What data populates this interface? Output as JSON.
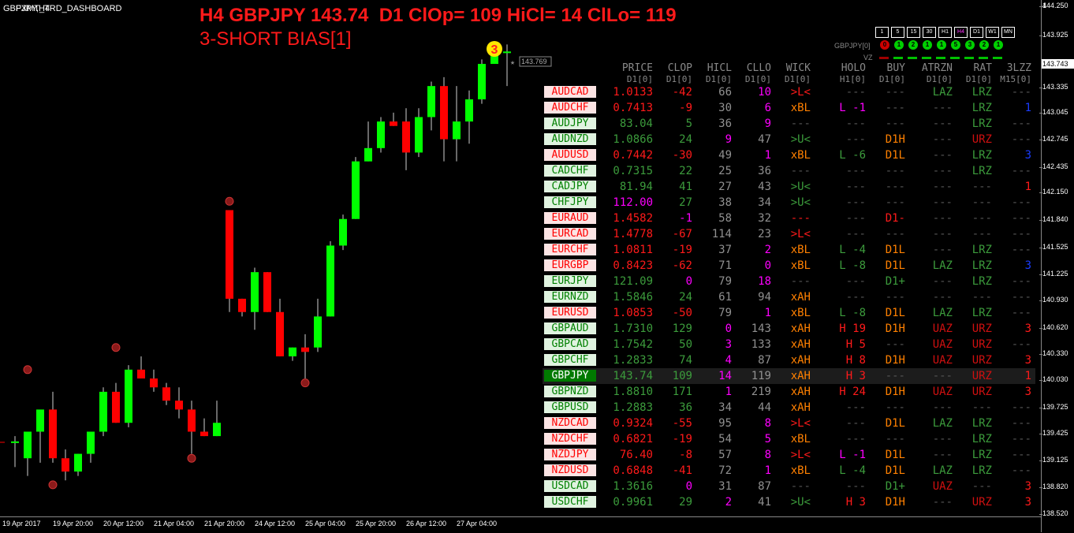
{
  "window": {
    "symbol_label": "GBPJPY,H4",
    "indicator_label": "FXMT_TRD_DASHBOARD"
  },
  "header": {
    "line1": "H4 GBPJPY 143.74  D1 ClOp= 109 HiCl= 14 ClLo= 119",
    "line2": "3-SHORT BIAS[1]",
    "color": "#ff1a1a"
  },
  "badge": {
    "text": "3",
    "color": "#ffe600"
  },
  "price_label": "143.769",
  "current_price": "143.743",
  "price_axis": [
    "144.250",
    "143.925",
    "143.743",
    "143.335",
    "143.045",
    "142.745",
    "142.435",
    "142.150",
    "141.840",
    "141.525",
    "141.225",
    "140.930",
    "140.620",
    "140.330",
    "140.030",
    "139.725",
    "139.425",
    "139.125",
    "138.820",
    "138.520"
  ],
  "time_axis": [
    "19 Apr 2017",
    "19 Apr 20:00",
    "20 Apr 12:00",
    "21 Apr 04:00",
    "21 Apr 20:00",
    "24 Apr 12:00",
    "25 Apr 04:00",
    "25 Apr 20:00",
    "26 Apr 12:00",
    "27 Apr 04:00"
  ],
  "timeframes": [
    "1",
    "5",
    "15",
    "30",
    "H1",
    "H4",
    "D1",
    "W1",
    "MN"
  ],
  "active_timeframe": "H4",
  "pair_label": "GBPJPY[0]",
  "signals": [
    {
      "text": "0",
      "color": "red"
    },
    {
      "text": "1",
      "color": "green"
    },
    {
      "text": "2",
      "color": "green"
    },
    {
      "text": "1",
      "color": "green"
    },
    {
      "text": "1",
      "color": "green"
    },
    {
      "text": "5",
      "color": "green"
    },
    {
      "text": "3",
      "color": "green"
    },
    {
      "text": "2",
      "color": "green"
    },
    {
      "text": "1",
      "color": "green"
    }
  ],
  "vz_label": "VZ",
  "vz_bars": [
    "red",
    "green",
    "green",
    "green",
    "green",
    "green",
    "green",
    "green",
    "green"
  ],
  "columns": [
    {
      "name": "PRICE",
      "sub": "D1[0]"
    },
    {
      "name": "CLOP",
      "sub": "D1[0]"
    },
    {
      "name": "HICL",
      "sub": "D1[0]"
    },
    {
      "name": "CLLO",
      "sub": "D1[0]"
    },
    {
      "name": "WICK",
      "sub": "D1[0]"
    },
    {
      "name": "HOLO",
      "sub": "H1[0]"
    },
    {
      "name": "BUY",
      "sub": "D1[0]"
    },
    {
      "name": "ATRZN",
      "sub": "D1[0]"
    },
    {
      "name": "RAT",
      "sub": "D1[0]"
    },
    {
      "name": "3LZZ",
      "sub": "M15[0]"
    }
  ],
  "rows": [
    {
      "pair": "AUDCAD",
      "style": "red",
      "price": "1.0133",
      "price_c": "cR",
      "clop": "-42",
      "clop_c": "cR",
      "hicl": "66",
      "hicl_c": "cGr",
      "cllo": "10",
      "cllo_c": "cM",
      "wick": ">L<",
      "wick_c": "cR",
      "holo": "---",
      "holo_c": "cDk",
      "buy": "---",
      "buy_c": "cDk",
      "atr": "LAZ",
      "atr_c": "cDG",
      "rat": "LRZ",
      "rat_c": "cDG",
      "lzz": "---",
      "lzz_c": "cDk"
    },
    {
      "pair": "AUDCHF",
      "style": "red",
      "price": "0.7413",
      "price_c": "cR",
      "clop": "-9",
      "clop_c": "cR",
      "hicl": "30",
      "hicl_c": "cGr",
      "cllo": "6",
      "cllo_c": "cM",
      "wick": "xBL",
      "wick_c": "cO",
      "holo": "L -1",
      "holo_c": "cM",
      "buy": "---",
      "buy_c": "cDk",
      "atr": "---",
      "atr_c": "cDk",
      "rat": "LRZ",
      "rat_c": "cDG",
      "lzz": "1",
      "lzz_c": "cB"
    },
    {
      "pair": "AUDJPY",
      "style": "green",
      "price": "83.04",
      "price_c": "cDG",
      "clop": "5",
      "clop_c": "cDG",
      "hicl": "36",
      "hicl_c": "cGr",
      "cllo": "9",
      "cllo_c": "cM",
      "wick": "---",
      "wick_c": "cDk",
      "holo": "---",
      "holo_c": "cDk",
      "buy": "---",
      "buy_c": "cDk",
      "atr": "---",
      "atr_c": "cDk",
      "rat": "LRZ",
      "rat_c": "cDG",
      "lzz": "---",
      "lzz_c": "cDk"
    },
    {
      "pair": "AUDNZD",
      "style": "green",
      "price": "1.0866",
      "price_c": "cDG",
      "clop": "24",
      "clop_c": "cDG",
      "hicl": "9",
      "hicl_c": "cM",
      "cllo": "47",
      "cllo_c": "cGr",
      "wick": ">U<",
      "wick_c": "cDG",
      "holo": "---",
      "holo_c": "cDk",
      "buy": "D1H",
      "buy_c": "cO",
      "atr": "---",
      "atr_c": "cDk",
      "rat": "URZ",
      "rat_c": "cDR",
      "lzz": "---",
      "lzz_c": "cDk"
    },
    {
      "pair": "AUDUSD",
      "style": "red",
      "price": "0.7442",
      "price_c": "cR",
      "clop": "-30",
      "clop_c": "cR",
      "hicl": "49",
      "hicl_c": "cGr",
      "cllo": "1",
      "cllo_c": "cM",
      "wick": "xBL",
      "wick_c": "cO",
      "holo": "L -6",
      "holo_c": "cDG",
      "buy": "D1L",
      "buy_c": "cO",
      "atr": "---",
      "atr_c": "cDk",
      "rat": "LRZ",
      "rat_c": "cDG",
      "lzz": "3",
      "lzz_c": "cB"
    },
    {
      "pair": "CADCHF",
      "style": "green",
      "price": "0.7315",
      "price_c": "cDG",
      "clop": "22",
      "clop_c": "cDG",
      "hicl": "25",
      "hicl_c": "cGr",
      "cllo": "36",
      "cllo_c": "cGr",
      "wick": "---",
      "wick_c": "cDk",
      "holo": "---",
      "holo_c": "cDk",
      "buy": "---",
      "buy_c": "cDk",
      "atr": "---",
      "atr_c": "cDk",
      "rat": "LRZ",
      "rat_c": "cDG",
      "lzz": "---",
      "lzz_c": "cDk"
    },
    {
      "pair": "CADJPY",
      "style": "green",
      "price": "81.94",
      "price_c": "cDG",
      "clop": "41",
      "clop_c": "cDG",
      "hicl": "27",
      "hicl_c": "cGr",
      "cllo": "43",
      "cllo_c": "cGr",
      "wick": ">U<",
      "wick_c": "cDG",
      "holo": "---",
      "holo_c": "cDk",
      "buy": "---",
      "buy_c": "cDk",
      "atr": "---",
      "atr_c": "cDk",
      "rat": "---",
      "rat_c": "cDk",
      "lzz": "1",
      "lzz_c": "cR"
    },
    {
      "pair": "CHFJPY",
      "style": "green",
      "price": "112.00",
      "price_c": "cM",
      "clop": "27",
      "clop_c": "cDG",
      "hicl": "38",
      "hicl_c": "cGr",
      "cllo": "34",
      "cllo_c": "cGr",
      "wick": ">U<",
      "wick_c": "cDG",
      "holo": "---",
      "holo_c": "cDk",
      "buy": "---",
      "buy_c": "cDk",
      "atr": "---",
      "atr_c": "cDk",
      "rat": "---",
      "rat_c": "cDk",
      "lzz": "---",
      "lzz_c": "cDk"
    },
    {
      "pair": "EURAUD",
      "style": "red",
      "price": "1.4582",
      "price_c": "cR",
      "clop": "-1",
      "clop_c": "cM",
      "hicl": "58",
      "hicl_c": "cGr",
      "cllo": "32",
      "cllo_c": "cGr",
      "wick": "---",
      "wick_c": "cR",
      "holo": "---",
      "holo_c": "cDk",
      "buy": "D1-",
      "buy_c": "cR",
      "atr": "---",
      "atr_c": "cDk",
      "rat": "---",
      "rat_c": "cDk",
      "lzz": "---",
      "lzz_c": "cDk"
    },
    {
      "pair": "EURCAD",
      "style": "red",
      "price": "1.4778",
      "price_c": "cR",
      "clop": "-67",
      "clop_c": "cR",
      "hicl": "114",
      "hicl_c": "cGr",
      "cllo": "23",
      "cllo_c": "cGr",
      "wick": ">L<",
      "wick_c": "cR",
      "holo": "---",
      "holo_c": "cDk",
      "buy": "---",
      "buy_c": "cDk",
      "atr": "---",
      "atr_c": "cDk",
      "rat": "---",
      "rat_c": "cDk",
      "lzz": "---",
      "lzz_c": "cDk"
    },
    {
      "pair": "EURCHF",
      "style": "red",
      "price": "1.0811",
      "price_c": "cR",
      "clop": "-19",
      "clop_c": "cR",
      "hicl": "37",
      "hicl_c": "cGr",
      "cllo": "2",
      "cllo_c": "cM",
      "wick": "xBL",
      "wick_c": "cO",
      "holo": "L -4",
      "holo_c": "cDG",
      "buy": "D1L",
      "buy_c": "cO",
      "atr": "---",
      "atr_c": "cDk",
      "rat": "LRZ",
      "rat_c": "cDG",
      "lzz": "---",
      "lzz_c": "cDk"
    },
    {
      "pair": "EURGBP",
      "style": "red",
      "price": "0.8423",
      "price_c": "cR",
      "clop": "-62",
      "clop_c": "cR",
      "hicl": "71",
      "hicl_c": "cGr",
      "cllo": "0",
      "cllo_c": "cM",
      "wick": "xBL",
      "wick_c": "cO",
      "holo": "L -8",
      "holo_c": "cDG",
      "buy": "D1L",
      "buy_c": "cO",
      "atr": "LAZ",
      "atr_c": "cDG",
      "rat": "LRZ",
      "rat_c": "cDG",
      "lzz": "3",
      "lzz_c": "cB"
    },
    {
      "pair": "EURJPY",
      "style": "green",
      "price": "121.09",
      "price_c": "cDG",
      "clop": "0",
      "clop_c": "cM",
      "hicl": "79",
      "hicl_c": "cGr",
      "cllo": "18",
      "cllo_c": "cM",
      "wick": "---",
      "wick_c": "cDk",
      "holo": "---",
      "holo_c": "cDk",
      "buy": "D1+",
      "buy_c": "cDG",
      "atr": "---",
      "atr_c": "cDk",
      "rat": "LRZ",
      "rat_c": "cDG",
      "lzz": "---",
      "lzz_c": "cDk"
    },
    {
      "pair": "EURNZD",
      "style": "green",
      "price": "1.5846",
      "price_c": "cDG",
      "clop": "24",
      "clop_c": "cDG",
      "hicl": "61",
      "hicl_c": "cGr",
      "cllo": "94",
      "cllo_c": "cGr",
      "wick": "xAH",
      "wick_c": "cO",
      "holo": "---",
      "holo_c": "cDk",
      "buy": "---",
      "buy_c": "cDk",
      "atr": "---",
      "atr_c": "cDk",
      "rat": "---",
      "rat_c": "cDk",
      "lzz": "---",
      "lzz_c": "cDk"
    },
    {
      "pair": "EURUSD",
      "style": "red",
      "price": "1.0853",
      "price_c": "cR",
      "clop": "-50",
      "clop_c": "cR",
      "hicl": "79",
      "hicl_c": "cGr",
      "cllo": "1",
      "cllo_c": "cM",
      "wick": "xBL",
      "wick_c": "cO",
      "holo": "L -8",
      "holo_c": "cDG",
      "buy": "D1L",
      "buy_c": "cO",
      "atr": "LAZ",
      "atr_c": "cDG",
      "rat": "LRZ",
      "rat_c": "cDG",
      "lzz": "---",
      "lzz_c": "cDk"
    },
    {
      "pair": "GBPAUD",
      "style": "green",
      "price": "1.7310",
      "price_c": "cDG",
      "clop": "129",
      "clop_c": "cDG",
      "hicl": "0",
      "hicl_c": "cM",
      "cllo": "143",
      "cllo_c": "cGr",
      "wick": "xAH",
      "wick_c": "cO",
      "holo": "H 19",
      "holo_c": "cR",
      "buy": "D1H",
      "buy_c": "cO",
      "atr": "UAZ",
      "atr_c": "cDR",
      "rat": "URZ",
      "rat_c": "cDR",
      "lzz": "3",
      "lzz_c": "cR"
    },
    {
      "pair": "GBPCAD",
      "style": "green",
      "price": "1.7542",
      "price_c": "cDG",
      "clop": "50",
      "clop_c": "cDG",
      "hicl": "3",
      "hicl_c": "cM",
      "cllo": "133",
      "cllo_c": "cGr",
      "wick": "xAH",
      "wick_c": "cO",
      "holo": "H 5",
      "holo_c": "cR",
      "buy": "---",
      "buy_c": "cDk",
      "atr": "UAZ",
      "atr_c": "cDR",
      "rat": "URZ",
      "rat_c": "cDR",
      "lzz": "---",
      "lzz_c": "cDk"
    },
    {
      "pair": "GBPCHF",
      "style": "green",
      "price": "1.2833",
      "price_c": "cDG",
      "clop": "74",
      "clop_c": "cDG",
      "hicl": "4",
      "hicl_c": "cM",
      "cllo": "87",
      "cllo_c": "cGr",
      "wick": "xAH",
      "wick_c": "cO",
      "holo": "H 8",
      "holo_c": "cR",
      "buy": "D1H",
      "buy_c": "cO",
      "atr": "UAZ",
      "atr_c": "cDR",
      "rat": "URZ",
      "rat_c": "cDR",
      "lzz": "3",
      "lzz_c": "cR"
    },
    {
      "pair": "GBPJPY",
      "style": "sel",
      "price": "143.74",
      "price_c": "cDG",
      "clop": "109",
      "clop_c": "cDG",
      "hicl": "14",
      "hicl_c": "cM",
      "cllo": "119",
      "cllo_c": "cGr",
      "wick": "xAH",
      "wick_c": "cO",
      "holo": "H 3",
      "holo_c": "cR",
      "buy": "---",
      "buy_c": "cDk",
      "atr": "---",
      "atr_c": "cDk",
      "rat": "URZ",
      "rat_c": "cDR",
      "lzz": "1",
      "lzz_c": "cR"
    },
    {
      "pair": "GBPNZD",
      "style": "green",
      "price": "1.8810",
      "price_c": "cDG",
      "clop": "171",
      "clop_c": "cDG",
      "hicl": "1",
      "hicl_c": "cM",
      "cllo": "219",
      "cllo_c": "cGr",
      "wick": "xAH",
      "wick_c": "cO",
      "holo": "H 24",
      "holo_c": "cR",
      "buy": "D1H",
      "buy_c": "cO",
      "atr": "UAZ",
      "atr_c": "cDR",
      "rat": "URZ",
      "rat_c": "cDR",
      "lzz": "3",
      "lzz_c": "cR"
    },
    {
      "pair": "GBPUSD",
      "style": "green",
      "price": "1.2883",
      "price_c": "cDG",
      "clop": "36",
      "clop_c": "cDG",
      "hicl": "34",
      "hicl_c": "cGr",
      "cllo": "44",
      "cllo_c": "cGr",
      "wick": "xAH",
      "wick_c": "cO",
      "holo": "---",
      "holo_c": "cDk",
      "buy": "---",
      "buy_c": "cDk",
      "atr": "---",
      "atr_c": "cDk",
      "rat": "---",
      "rat_c": "cDk",
      "lzz": "---",
      "lzz_c": "cDk"
    },
    {
      "pair": "NZDCAD",
      "style": "red",
      "price": "0.9324",
      "price_c": "cR",
      "clop": "-55",
      "clop_c": "cR",
      "hicl": "95",
      "hicl_c": "cGr",
      "cllo": "8",
      "cllo_c": "cM",
      "wick": ">L<",
      "wick_c": "cR",
      "holo": "---",
      "holo_c": "cDk",
      "buy": "D1L",
      "buy_c": "cO",
      "atr": "LAZ",
      "atr_c": "cDG",
      "rat": "LRZ",
      "rat_c": "cDG",
      "lzz": "---",
      "lzz_c": "cDk"
    },
    {
      "pair": "NZDCHF",
      "style": "red",
      "price": "0.6821",
      "price_c": "cR",
      "clop": "-19",
      "clop_c": "cR",
      "hicl": "54",
      "hicl_c": "cGr",
      "cllo": "5",
      "cllo_c": "cM",
      "wick": "xBL",
      "wick_c": "cO",
      "holo": "---",
      "holo_c": "cDk",
      "buy": "---",
      "buy_c": "cDk",
      "atr": "---",
      "atr_c": "cDk",
      "rat": "LRZ",
      "rat_c": "cDG",
      "lzz": "---",
      "lzz_c": "cDk"
    },
    {
      "pair": "NZDJPY",
      "style": "red",
      "price": "76.40",
      "price_c": "cR",
      "clop": "-8",
      "clop_c": "cR",
      "hicl": "57",
      "hicl_c": "cGr",
      "cllo": "8",
      "cllo_c": "cM",
      "wick": ">L<",
      "wick_c": "cR",
      "holo": "L -1",
      "holo_c": "cM",
      "buy": "D1L",
      "buy_c": "cO",
      "atr": "---",
      "atr_c": "cDk",
      "rat": "LRZ",
      "rat_c": "cDG",
      "lzz": "---",
      "lzz_c": "cDk"
    },
    {
      "pair": "NZDUSD",
      "style": "red",
      "price": "0.6848",
      "price_c": "cR",
      "clop": "-41",
      "clop_c": "cR",
      "hicl": "72",
      "hicl_c": "cGr",
      "cllo": "1",
      "cllo_c": "cM",
      "wick": "xBL",
      "wick_c": "cO",
      "holo": "L -4",
      "holo_c": "cDG",
      "buy": "D1L",
      "buy_c": "cO",
      "atr": "LAZ",
      "atr_c": "cDG",
      "rat": "LRZ",
      "rat_c": "cDG",
      "lzz": "---",
      "lzz_c": "cDk"
    },
    {
      "pair": "USDCAD",
      "style": "green",
      "price": "1.3616",
      "price_c": "cDG",
      "clop": "0",
      "clop_c": "cM",
      "hicl": "31",
      "hicl_c": "cGr",
      "cllo": "87",
      "cllo_c": "cGr",
      "wick": "---",
      "wick_c": "cDk",
      "holo": "---",
      "holo_c": "cDk",
      "buy": "D1+",
      "buy_c": "cDG",
      "atr": "UAZ",
      "atr_c": "cDR",
      "rat": "---",
      "rat_c": "cDk",
      "lzz": "3",
      "lzz_c": "cR"
    },
    {
      "pair": "USDCHF",
      "style": "green",
      "price": "0.9961",
      "price_c": "cDG",
      "clop": "29",
      "clop_c": "cDG",
      "hicl": "2",
      "hicl_c": "cM",
      "cllo": "41",
      "cllo_c": "cGr",
      "wick": ">U<",
      "wick_c": "cDG",
      "holo": "H 3",
      "holo_c": "cR",
      "buy": "D1H",
      "buy_c": "cO",
      "atr": "---",
      "atr_c": "cDk",
      "rat": "URZ",
      "rat_c": "cDR",
      "lzz": "3",
      "lzz_c": "cR"
    }
  ],
  "candles": [
    {
      "o": 139.33,
      "h": 139.4,
      "l": 139.05,
      "c": 139.34
    },
    {
      "o": 139.15,
      "h": 139.25,
      "l": 138.95,
      "c": 139.45
    },
    {
      "o": 139.45,
      "h": 139.6,
      "l": 139.1,
      "c": 139.7
    },
    {
      "o": 139.7,
      "h": 139.9,
      "l": 139.1,
      "c": 139.15
    },
    {
      "o": 139.15,
      "h": 139.25,
      "l": 138.9,
      "c": 139.0
    },
    {
      "o": 139.0,
      "h": 139.2,
      "l": 138.95,
      "c": 139.2
    },
    {
      "o": 139.2,
      "h": 139.35,
      "l": 139.1,
      "c": 139.45
    },
    {
      "o": 139.45,
      "h": 139.95,
      "l": 139.4,
      "c": 139.9
    },
    {
      "o": 139.9,
      "h": 140.0,
      "l": 139.55,
      "c": 139.55
    },
    {
      "o": 139.55,
      "h": 140.2,
      "l": 139.5,
      "c": 140.15
    },
    {
      "o": 140.15,
      "h": 140.3,
      "l": 140.05,
      "c": 140.05
    },
    {
      "o": 140.05,
      "h": 140.15,
      "l": 139.9,
      "c": 139.95
    },
    {
      "o": 139.95,
      "h": 140.0,
      "l": 139.75,
      "c": 139.8
    },
    {
      "o": 139.8,
      "h": 139.95,
      "l": 139.6,
      "c": 139.7
    },
    {
      "o": 139.7,
      "h": 139.8,
      "l": 139.2,
      "c": 139.45
    },
    {
      "o": 139.45,
      "h": 139.6,
      "l": 139.4,
      "c": 139.4
    },
    {
      "o": 139.4,
      "h": 139.8,
      "l": 139.4,
      "c": 139.55
    },
    {
      "o": 141.95,
      "h": 141.95,
      "l": 140.8,
      "c": 140.95
    },
    {
      "o": 140.95,
      "h": 140.95,
      "l": 140.75,
      "c": 140.8
    },
    {
      "o": 140.8,
      "h": 141.3,
      "l": 140.6,
      "c": 141.25
    },
    {
      "o": 141.25,
      "h": 141.25,
      "l": 140.8,
      "c": 140.8
    },
    {
      "o": 140.8,
      "h": 140.95,
      "l": 140.3,
      "c": 140.3
    },
    {
      "o": 140.3,
      "h": 140.4,
      "l": 140.25,
      "c": 140.4
    },
    {
      "o": 140.4,
      "h": 140.55,
      "l": 140.05,
      "c": 140.35
    },
    {
      "o": 140.4,
      "h": 140.95,
      "l": 140.35,
      "c": 140.75
    },
    {
      "o": 140.75,
      "h": 141.6,
      "l": 140.75,
      "c": 141.55
    },
    {
      "o": 141.55,
      "h": 141.9,
      "l": 141.5,
      "c": 141.85
    },
    {
      "o": 141.85,
      "h": 142.55,
      "l": 141.85,
      "c": 142.5
    },
    {
      "o": 142.5,
      "h": 142.95,
      "l": 142.5,
      "c": 142.65
    },
    {
      "o": 142.65,
      "h": 143.0,
      "l": 142.6,
      "c": 142.95
    },
    {
      "o": 142.95,
      "h": 143.05,
      "l": 142.9,
      "c": 142.9
    },
    {
      "o": 142.95,
      "h": 143.1,
      "l": 142.4,
      "c": 142.6
    },
    {
      "o": 142.6,
      "h": 143.1,
      "l": 142.55,
      "c": 143.0
    },
    {
      "o": 143.0,
      "h": 143.4,
      "l": 142.85,
      "c": 143.35
    },
    {
      "o": 143.35,
      "h": 143.45,
      "l": 142.5,
      "c": 142.75
    },
    {
      "o": 142.75,
      "h": 143.35,
      "l": 142.5,
      "c": 142.95
    },
    {
      "o": 142.95,
      "h": 143.3,
      "l": 142.7,
      "c": 143.2
    },
    {
      "o": 143.2,
      "h": 143.65,
      "l": 143.15,
      "c": 143.6
    },
    {
      "o": 143.6,
      "h": 143.8,
      "l": 143.6,
      "c": 143.8
    },
    {
      "o": 143.74,
      "h": 143.82,
      "l": 143.35,
      "c": 143.74
    }
  ],
  "fractal_marks": [
    {
      "i": 1,
      "price": 140.15
    },
    {
      "i": 3,
      "price": 138.85
    },
    {
      "i": 8,
      "price": 140.4
    },
    {
      "i": 14,
      "price": 139.15
    },
    {
      "i": 17,
      "price": 142.05
    },
    {
      "i": 23,
      "price": 140.0
    }
  ]
}
